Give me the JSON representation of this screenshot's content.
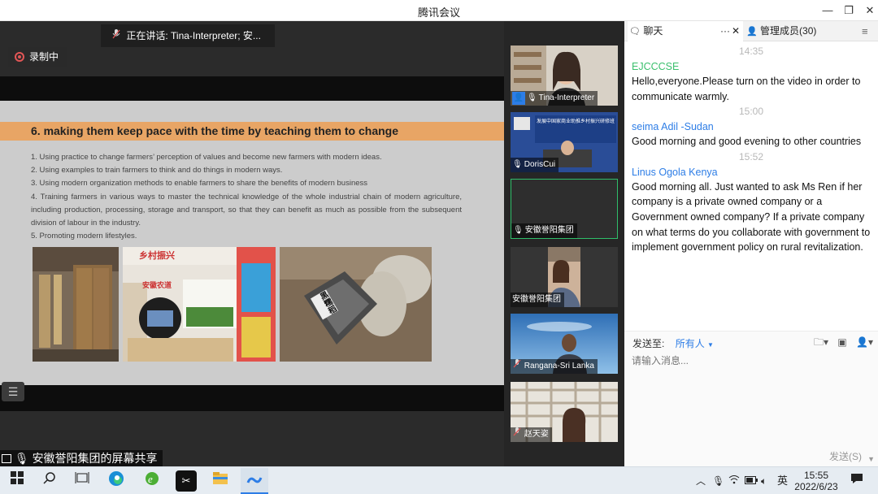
{
  "window": {
    "title": "腾讯会议",
    "controls": [
      "—",
      "❐",
      "✕"
    ]
  },
  "meeting": {
    "speaking_label": "正在讲话: Tina-Interpreter; 安...",
    "recording_label": "录制中",
    "share_label": "安徽誉阳集团的屏幕共享",
    "list_icon": "list-icon"
  },
  "slide": {
    "heading": "6. making them keep pace with the time by teaching them to change",
    "points": [
      "1. Using practice to change farmers’   perception of values and become new farmers with modern ideas.",
      "2. Using examples to train farmers to think and do things in modern ways.",
      "3. Using modern organization methods to enable farmers to share the benefits of modern business",
      "4. Training farmers in various ways to master the technical knowledge of the whole industrial chain of modern agriculture, including production, processing, storage and transport, so that they can benefit as much as possible from the subsequent division of labour in the industry.",
      "5. Promoting modern lifestyles."
    ],
    "photo2_sign": "乡村振兴",
    "photo2_sub": "安徽农道",
    "photo3_label": "黑糯稻"
  },
  "participants": [
    {
      "name": "Tina-Interpreter",
      "mic": "mic-icon"
    },
    {
      "name": "DorisCui",
      "mic": "mic-icon",
      "banner": "发展中国家商业助推乡村振兴研修班"
    },
    {
      "name": "安徽誉阳集团",
      "mic": "mic-icon"
    },
    {
      "name": "安徽誉阳集团",
      "mic": "none"
    },
    {
      "name": "Rangana-Sri Lanka",
      "mic": "mic-muted-icon"
    },
    {
      "name": "赵天姿",
      "mic": "mic-muted-icon"
    }
  ],
  "panel": {
    "chat_tab": "聊天",
    "more": "···",
    "close": "✕",
    "members_tab": "管理成员(30)",
    "menu": "≡"
  },
  "chat": [
    {
      "time": "14:35",
      "sender": "EJCCCSE",
      "color": "#3cc06e",
      "text": "Hello,everyone.Please turn on the video in order to communicate warmly."
    },
    {
      "time": "15:00",
      "sender": "seima Adil -Sudan",
      "color": "#2d7de6",
      "text": "Good morning and good evening to other countries"
    },
    {
      "time": "15:52",
      "sender": "Linus Ogola Kenya",
      "color": "#2d7de6",
      "text": "Good morning all. Just wanted to ask Ms Ren if her company is a private owned company or a Government owned company? If a private company on what terms do you collaborate with government to implement government policy on rural revitalization."
    }
  ],
  "composer": {
    "send_to_label": "发送至:",
    "recipient": "所有人",
    "placeholder": "请输入消息...",
    "send_button": "发送(S)"
  },
  "taskbar": {
    "apps": [
      "windows-start-icon",
      "search-icon",
      "task-view-icon",
      "edge-icon",
      "ie-icon",
      "capcut-icon",
      "file-explorer-icon",
      "tencent-meeting-icon"
    ],
    "ime": "英",
    "time": "15:55",
    "date": "2022/6/23"
  },
  "colors": {
    "accent": "#2d7de6",
    "green_sender": "#3cc06e",
    "slide_header": "#e8a565",
    "recording": "#e25656"
  }
}
